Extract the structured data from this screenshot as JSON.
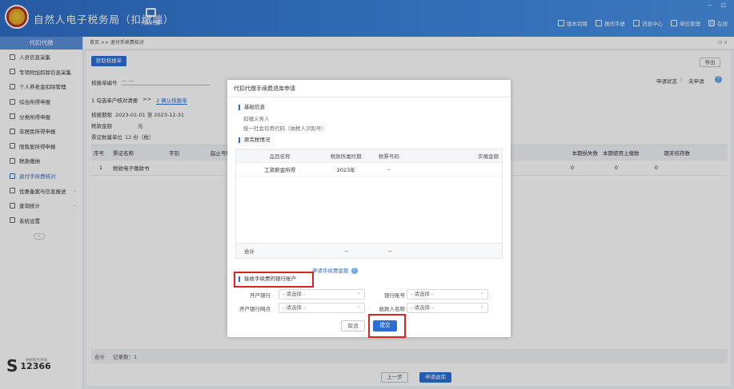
{
  "header": {
    "app_title": "自然人电子税务局（扣缴端）",
    "proxy_label": "代扣代缴",
    "tools": [
      "版本切换",
      "操作手册",
      "消息中心",
      "单位管理",
      "在线"
    ],
    "window_controls": "− ⊡"
  },
  "sidebar": {
    "head": "代扣代缴",
    "items": [
      {
        "label": "人员信息采集"
      },
      {
        "label": "专项附加扣除信息采集"
      },
      {
        "label": "个人养老金扣除管理"
      },
      {
        "label": "综合所得申报"
      },
      {
        "label": "分类所得申报"
      },
      {
        "label": "非居民所得申报"
      },
      {
        "label": "限售股所得申报"
      },
      {
        "label": "税款缴纳"
      },
      {
        "label": "退付手续费核对"
      },
      {
        "label": "优惠备案与信息报送"
      },
      {
        "label": "查询统计"
      },
      {
        "label": "系统设置"
      }
    ],
    "hotline_label": "纳税服务热线",
    "hotline_number": "12366"
  },
  "breadcrumb": {
    "text": "首页 >> 退付手续费核对",
    "close": "⊡ ×"
  },
  "content": {
    "get_btn": "获取核报单",
    "report_no_label": "核报单编号",
    "report_no_value": "一 一",
    "export_btn": "导出",
    "apply_status_label": "申请状态",
    "apply_status_value": "未申请",
    "steps": [
      "1 勾选单户核对清册",
      ">>",
      "2 确认核报单"
    ],
    "period_label": "核报期限",
    "period_value": "2023-01-01 至 2023-12-31",
    "tax_amount_label": "税款金额",
    "tax_amount_value": "元",
    "voucher_label": "票证数量单位",
    "voucher_value": "12 份（枚）",
    "col_headers_left": [
      "序号",
      "票证名称",
      "字别",
      "起止号码"
    ],
    "col_headers_right": [
      "本期损失数",
      "本期使用上缴数",
      "期末结存数"
    ],
    "row": {
      "no": "1",
      "name": "税收电子缴款书",
      "v1": "0",
      "v2": "0",
      "v3": "0"
    },
    "footer_total": "合计",
    "footer_count": "记录数：1",
    "prev_btn": "上一步",
    "apply_btn": "申请退库"
  },
  "modal": {
    "title": "代扣代缴手续费退库申请",
    "basic_title": "基础信息",
    "withholder_label": "扣缴义务人",
    "credit_code_label": "统一社会信用代码（纳税人识别号）",
    "history_title": "原完税情况",
    "table_headers": [
      "品目名称",
      "税款所属时期",
      "税票号码",
      "实缴金额"
    ],
    "table_row": {
      "item": "工资薪金所得",
      "period": "2023年",
      "ticket": "--"
    },
    "total_label": "合计",
    "total_dash1": "--",
    "total_dash2": "--",
    "apply_amount_link": "申请手续费金额",
    "bank_title": "接收手续费的银行账户",
    "fields": {
      "bank_label": "开户银行",
      "bank_value": "- 请选择 -",
      "account_label": "银行账号",
      "account_value": "- 请选择 -",
      "branch_label": "开户银行网点",
      "branch_value": "- 请选择 -",
      "payee_label": "收款人名称",
      "payee_value": "- 请选择 -"
    },
    "cancel_btn": "取消",
    "submit_btn": "提交"
  }
}
